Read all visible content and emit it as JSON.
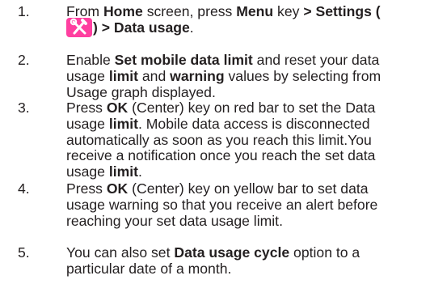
{
  "steps": [
    {
      "number": "1.",
      "parts": [
        {
          "t": "From ",
          "b": false
        },
        {
          "t": "Home",
          "b": true
        },
        {
          "t": " screen, press ",
          "b": false
        },
        {
          "t": "Menu",
          "b": true
        },
        {
          "t": " key ",
          "b": false
        },
        {
          "t": "> Settings (",
          "b": true
        },
        {
          "br": true
        },
        {
          "icon": "settings-tools-icon"
        },
        {
          "t": ") > Data usage",
          "b": true
        },
        {
          "t": ".",
          "b": false
        }
      ]
    },
    {
      "number": "2.",
      "parts": [
        {
          "t": "Enable ",
          "b": false
        },
        {
          "t": "Set mobile data limit",
          "b": true
        },
        {
          "t": " and reset your data",
          "b": false
        },
        {
          "br": true
        },
        {
          "t": "usage ",
          "b": false
        },
        {
          "t": "limit",
          "b": true
        },
        {
          "t": " and ",
          "b": false
        },
        {
          "t": "warning",
          "b": true
        },
        {
          "t": " values by selecting from",
          "b": false
        },
        {
          "br": true
        },
        {
          "t": "Usage graph displayed.",
          "b": false
        }
      ]
    },
    {
      "number": "3.",
      "parts": [
        {
          "t": "Press ",
          "b": false
        },
        {
          "t": "OK",
          "b": true
        },
        {
          "t": " (Center) key on red bar to set the Data",
          "b": false
        },
        {
          "br": true
        },
        {
          "t": "usage ",
          "b": false
        },
        {
          "t": "limit",
          "b": true
        },
        {
          "t": ". Mobile data access is disconnected",
          "b": false
        },
        {
          "br": true
        },
        {
          "t": "automatically as soon as you reach this limit.You",
          "b": false
        },
        {
          "br": true
        },
        {
          "t": "receive a notification once you reach the set data",
          "b": false
        },
        {
          "br": true
        },
        {
          "t": "usage ",
          "b": false
        },
        {
          "t": "limit",
          "b": true
        },
        {
          "t": ".",
          "b": false
        }
      ]
    },
    {
      "number": "4.",
      "parts": [
        {
          "t": "Press ",
          "b": false
        },
        {
          "t": "OK",
          "b": true
        },
        {
          "t": " (Center) key on yellow bar to set data",
          "b": false
        },
        {
          "br": true
        },
        {
          "t": "usage warning so that you receive an alert before",
          "b": false
        },
        {
          "br": true
        },
        {
          "t": "reaching your set data usage limit.",
          "b": false
        }
      ]
    },
    {
      "number": "5.",
      "parts": [
        {
          "t": "You can also set ",
          "b": false
        },
        {
          "t": "Data usage cycle",
          "b": true
        },
        {
          "t": " option to a",
          "b": false
        },
        {
          "br": true
        },
        {
          "t": "particular date of a month.",
          "b": false
        }
      ]
    }
  ]
}
